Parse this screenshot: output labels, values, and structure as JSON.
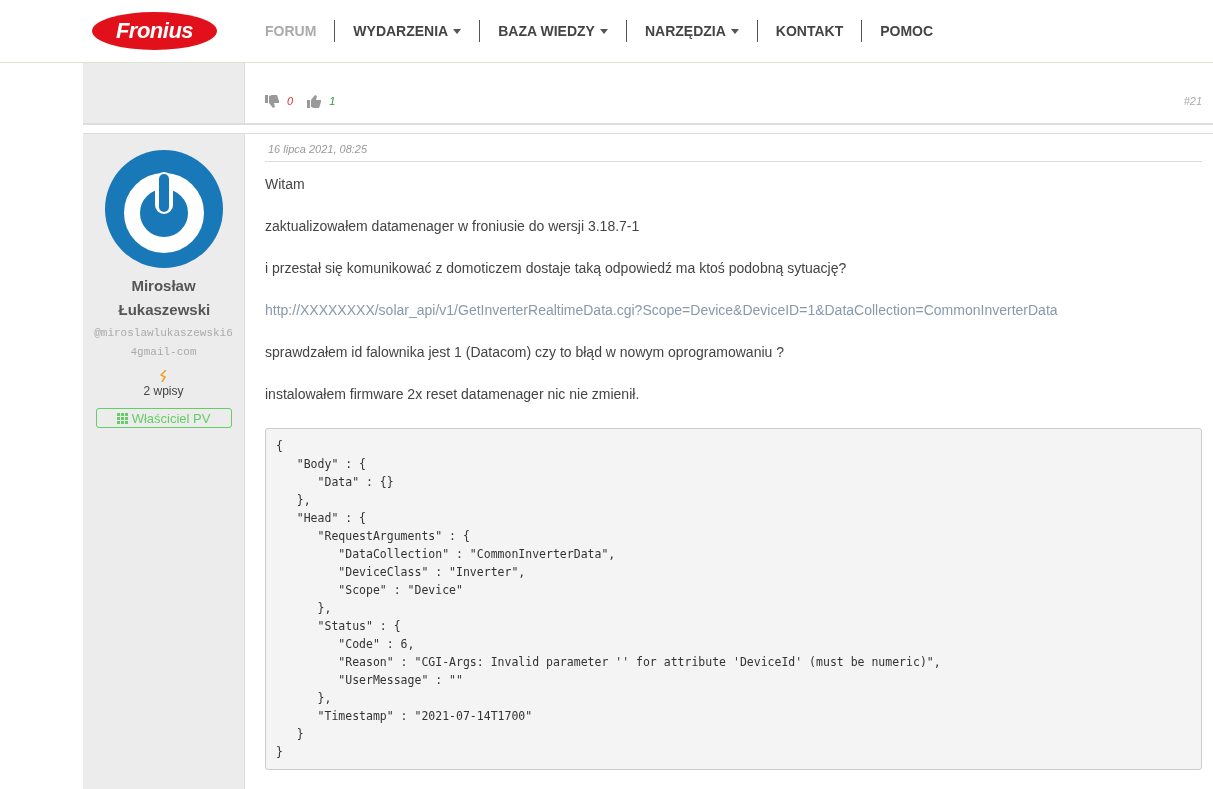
{
  "header": {
    "logo": "Fronius",
    "nav": [
      {
        "label": "FORUM",
        "selected": true,
        "dropdown": false
      },
      {
        "label": "WYDARZENIA",
        "selected": false,
        "dropdown": true
      },
      {
        "label": "BAZA WIEDZY",
        "selected": false,
        "dropdown": true
      },
      {
        "label": "NARZĘDZIA",
        "selected": false,
        "dropdown": true
      },
      {
        "label": "KONTAKT",
        "selected": false,
        "dropdown": false
      },
      {
        "label": "POMOC",
        "selected": false,
        "dropdown": false
      }
    ]
  },
  "previous_post": {
    "downvotes": "0",
    "upvotes": "1",
    "number": "#21"
  },
  "post": {
    "author": {
      "name": "Mirosław Łukaszewski",
      "handle": "@miroslawlukaszewski64gmail-com",
      "posts": "2 wpisy",
      "badge": "Właściciel PV"
    },
    "date": "16 lipca 2021, 08:25",
    "paragraphs": [
      {
        "kind": "text",
        "text": "Witam"
      },
      {
        "kind": "text",
        "text": "zaktualizowałem datamenager w froniusie do wersji 3.18.7-1"
      },
      {
        "kind": "text",
        "text": "i przestał się komunikować z domoticzem dostaje taką odpowiedź  ma ktoś podobną sytuację?"
      },
      {
        "kind": "link",
        "text": "http://XXXXXXXX/solar_api/v1/GetInverterRealtimeData.cgi?Scope=Device&DeviceID=1&DataCollection=CommonInverterData"
      },
      {
        "kind": "text",
        "text": "sprawdzałem id falownika jest 1 (Datacom) czy to błąd w nowym oprogramowaniu ?"
      },
      {
        "kind": "text",
        "text": "instalowałem firmware 2x reset datamenager  nic nie zmienił."
      }
    ],
    "code": "{\n   \"Body\" : {\n      \"Data\" : {}\n   },\n   \"Head\" : {\n      \"RequestArguments\" : {\n         \"DataCollection\" : \"CommonInverterData\",\n         \"DeviceClass\" : \"Inverter\",\n         \"Scope\" : \"Device\"\n      },\n      \"Status\" : {\n         \"Code\" : 6,\n         \"Reason\" : \"CGI-Args: Invalid parameter '' for attribute 'DeviceId' (must be numeric)\",\n         \"UserMessage\" : \"\"\n      },\n      \"Timestamp\" : \"2021-07-14T1700\"\n   }\n}"
  }
}
